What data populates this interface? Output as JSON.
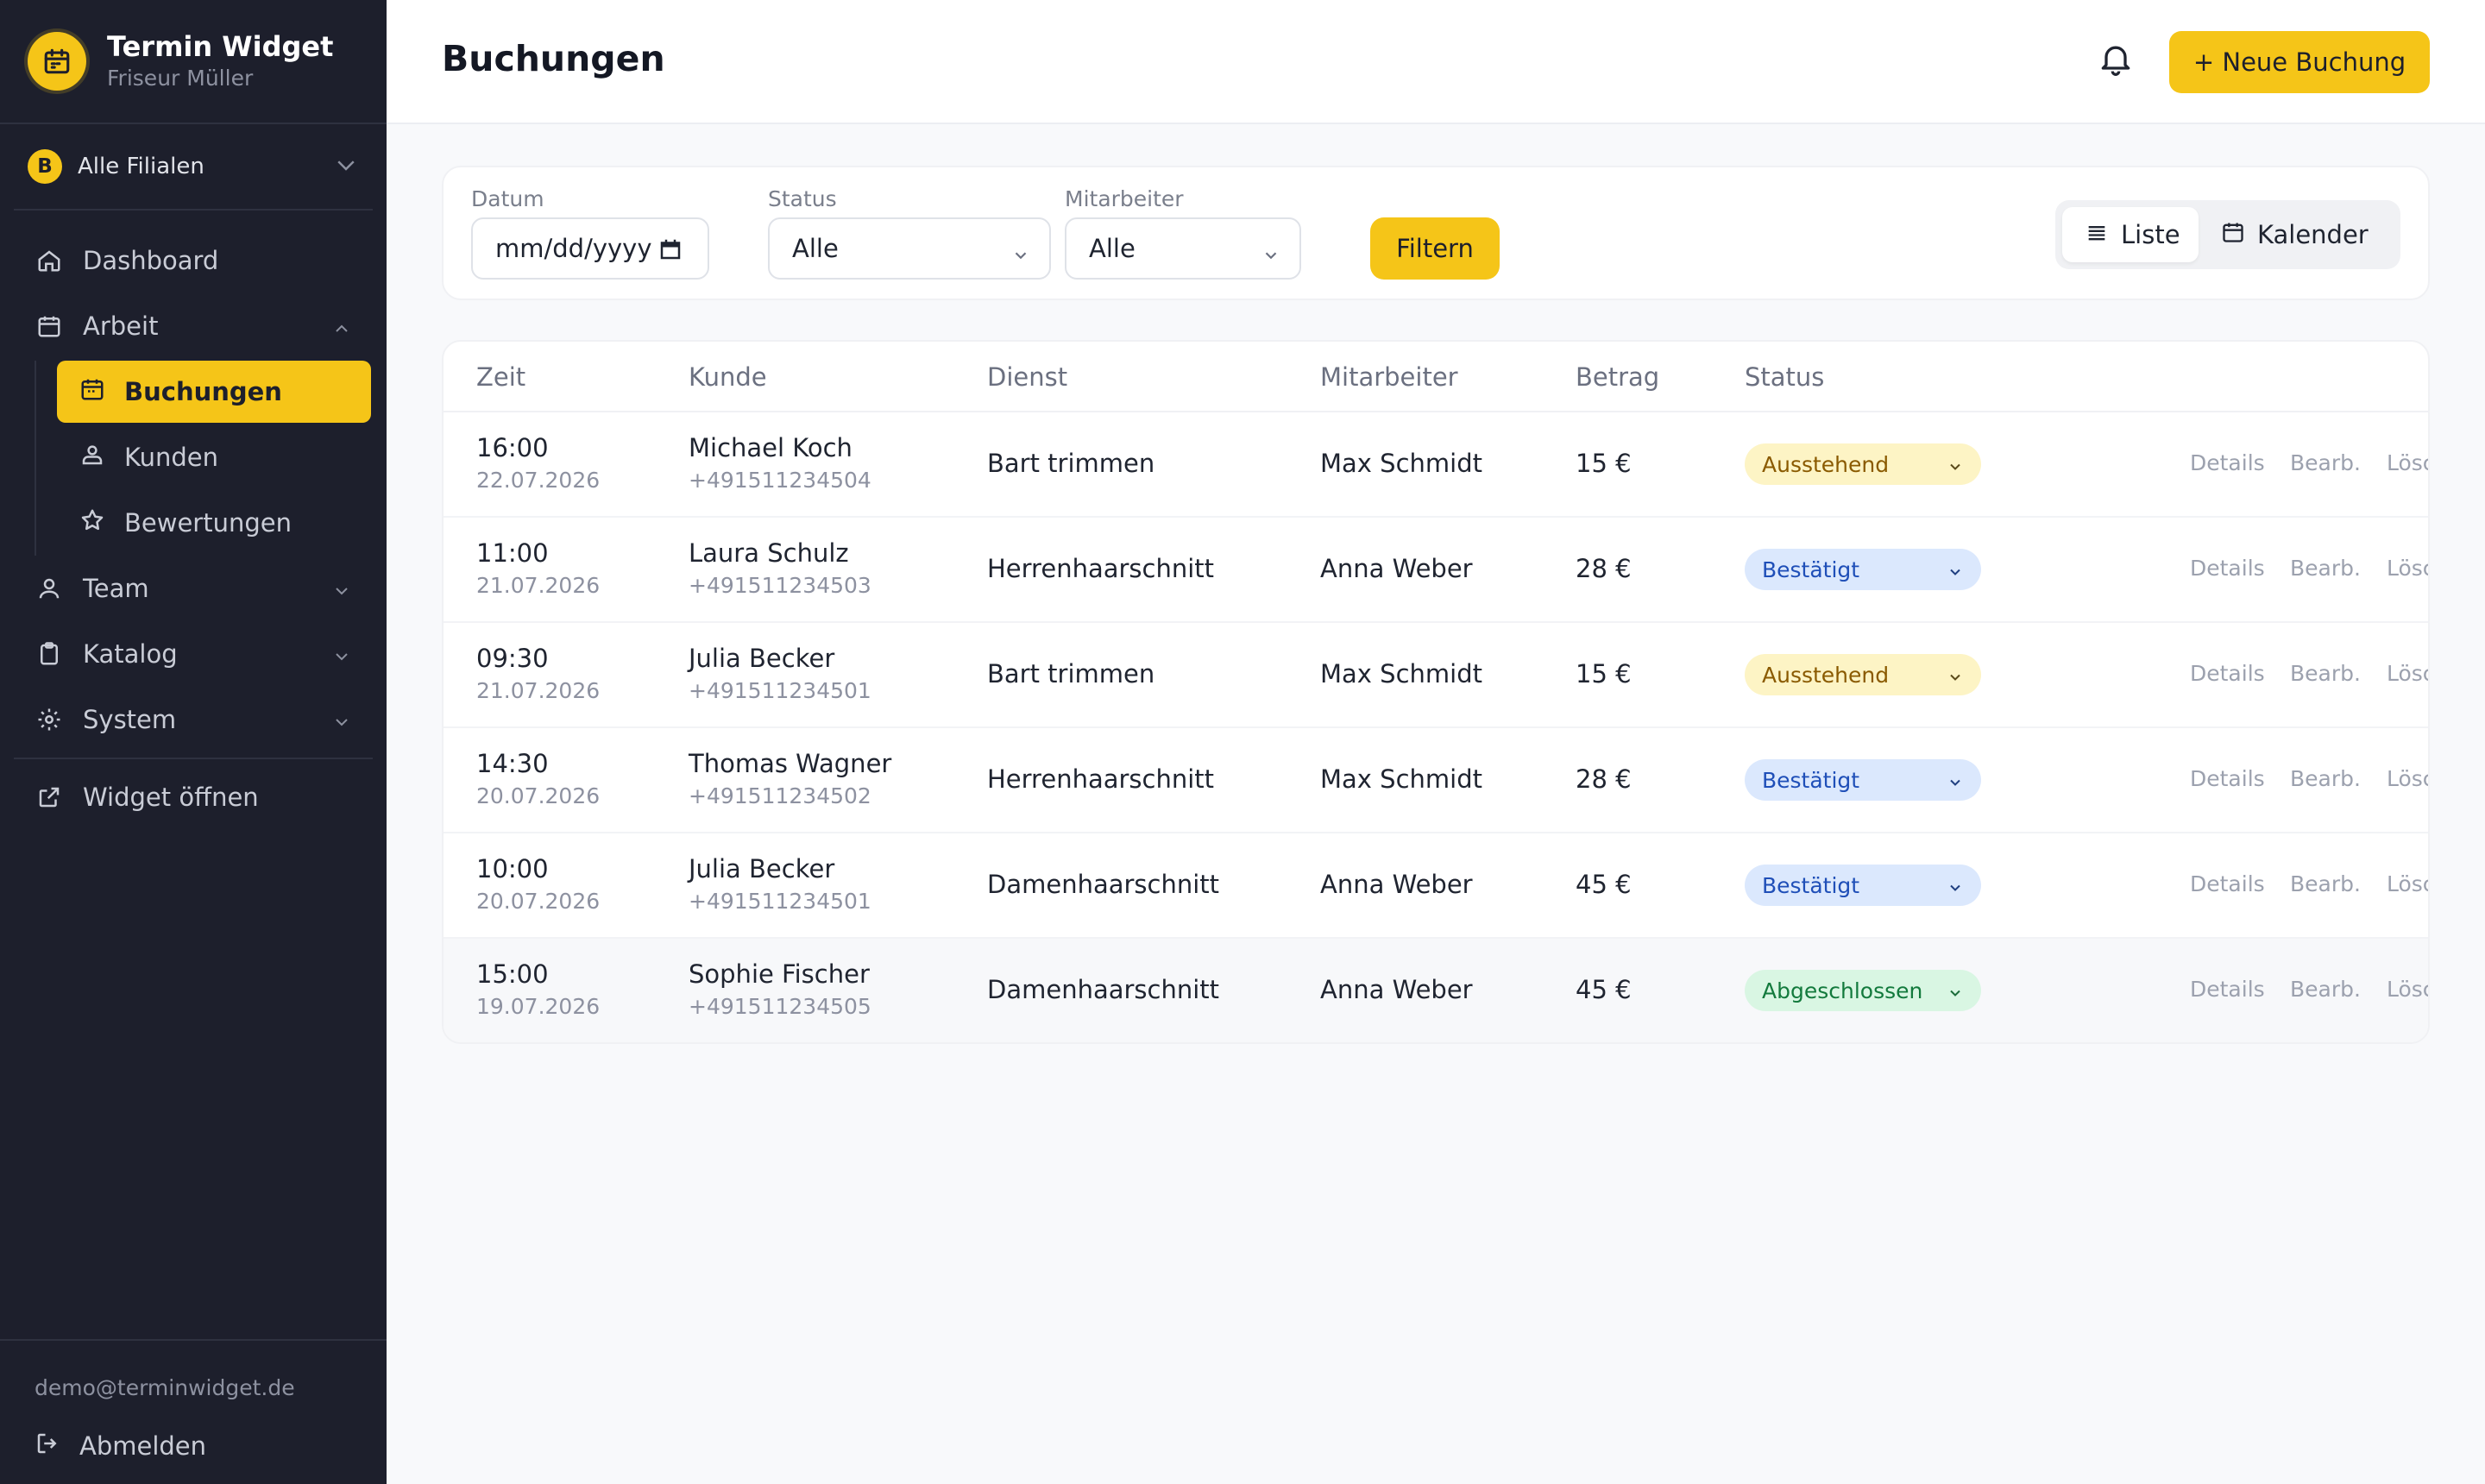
{
  "brand": {
    "title": "Termin Widget",
    "subtitle": "Friseur Müller"
  },
  "branch": {
    "badge": "B",
    "label": "Alle Filialen"
  },
  "nav": {
    "dashboard": "Dashboard",
    "work": "Arbeit",
    "work_items": [
      "Buchungen",
      "Kunden",
      "Bewertungen"
    ],
    "team": "Team",
    "catalog": "Katalog",
    "system": "System",
    "widget": "Widget öffnen"
  },
  "footer": {
    "email": "demo@terminwidget.de",
    "logout": "Abmelden"
  },
  "header": {
    "title": "Buchungen",
    "new_booking": "+ Neue Buchung"
  },
  "filters": {
    "date_label": "Datum",
    "date_placeholder": "mm/dd/yyyy",
    "status_label": "Status",
    "status_value": "Alle",
    "staff_label": "Mitarbeiter",
    "staff_value": "Alle",
    "filter_button": "Filtern"
  },
  "view_toggle": {
    "list": "Liste",
    "calendar": "Kalender",
    "active": "list"
  },
  "table": {
    "columns": [
      "Zeit",
      "Kunde",
      "Dienst",
      "Mitarbeiter",
      "Betrag",
      "Status"
    ],
    "actions": {
      "details": "Details",
      "edit": "Bearb.",
      "delete": "Lösch."
    },
    "rows": [
      {
        "time": "16:00",
        "date": "22.07.2026",
        "customer": "Michael Koch",
        "phone": "+491511234504",
        "service": "Bart trimmen",
        "staff": "Max Schmidt",
        "amount": "15 €",
        "status": "Ausstehend"
      },
      {
        "time": "11:00",
        "date": "21.07.2026",
        "customer": "Laura Schulz",
        "phone": "+491511234503",
        "service": "Herrenhaarschnitt",
        "staff": "Anna Weber",
        "amount": "28 €",
        "status": "Bestätigt"
      },
      {
        "time": "09:30",
        "date": "21.07.2026",
        "customer": "Julia Becker",
        "phone": "+491511234501",
        "service": "Bart trimmen",
        "staff": "Max Schmidt",
        "amount": "15 €",
        "status": "Ausstehend"
      },
      {
        "time": "14:30",
        "date": "20.07.2026",
        "customer": "Thomas Wagner",
        "phone": "+491511234502",
        "service": "Herrenhaarschnitt",
        "staff": "Max Schmidt",
        "amount": "28 €",
        "status": "Bestätigt"
      },
      {
        "time": "10:00",
        "date": "20.07.2026",
        "customer": "Julia Becker",
        "phone": "+491511234501",
        "service": "Damenhaarschnitt",
        "staff": "Anna Weber",
        "amount": "45 €",
        "status": "Bestätigt"
      },
      {
        "time": "15:00",
        "date": "19.07.2026",
        "customer": "Sophie Fischer",
        "phone": "+491511234505",
        "service": "Damenhaarschnitt",
        "staff": "Anna Weber",
        "amount": "45 €",
        "status": "Abgeschlossen"
      }
    ]
  },
  "colors": {
    "accent": "#f5c518",
    "sidebar_bg": "#1d1f2c",
    "status_pending": "#fdf4c5",
    "status_confirmed": "#dbe8fd",
    "status_done": "#d9f6e3"
  },
  "icons": {
    "brand": "calendar-icon",
    "dashboard": "home-icon",
    "work": "calendar-icon",
    "bookings": "calendar-icon",
    "customers": "users-icon",
    "reviews": "star-icon",
    "team": "user-icon",
    "catalog": "clipboard-icon",
    "system": "gear-icon",
    "widget": "external-link-icon",
    "logout": "logout-icon",
    "notifications": "bell-icon",
    "list": "list-icon",
    "calendar": "calendar-icon"
  }
}
